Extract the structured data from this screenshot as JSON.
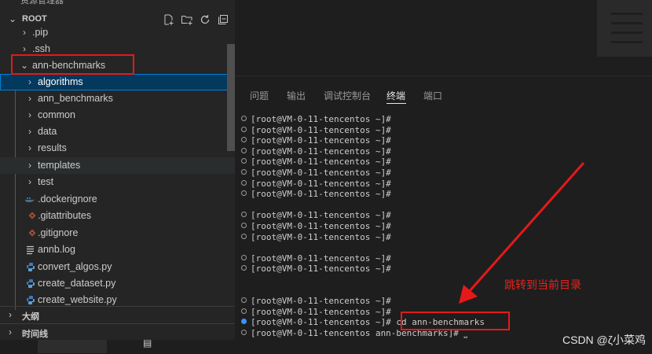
{
  "explorer": {
    "title_fragment": "资源管理器",
    "root_label": "ROOT",
    "header_icons": [
      "new-file-icon",
      "new-folder-icon",
      "refresh-icon",
      "collapse-all-icon"
    ],
    "items": [
      {
        "label": ".pip",
        "kind": "folder"
      },
      {
        "label": ".ssh",
        "kind": "folder"
      },
      {
        "label": "ann-benchmarks",
        "kind": "folder-open"
      },
      {
        "label": "algorithms",
        "kind": "folder",
        "selected": true
      },
      {
        "label": "ann_benchmarks",
        "kind": "folder"
      },
      {
        "label": "common",
        "kind": "folder"
      },
      {
        "label": "data",
        "kind": "folder"
      },
      {
        "label": "results",
        "kind": "folder"
      },
      {
        "label": "templates",
        "kind": "folder",
        "hover": true
      },
      {
        "label": "test",
        "kind": "folder"
      },
      {
        "label": ".dockerignore",
        "kind": "file",
        "icon": "docker-icon"
      },
      {
        "label": ".gitattributes",
        "kind": "file",
        "icon": "git-icon"
      },
      {
        "label": ".gitignore",
        "kind": "file",
        "icon": "git-icon"
      },
      {
        "label": "annb.log",
        "kind": "file",
        "icon": "log-icon"
      },
      {
        "label": "convert_algos.py",
        "kind": "file",
        "icon": "python-icon"
      },
      {
        "label": "create_dataset.py",
        "kind": "file",
        "icon": "python-icon"
      },
      {
        "label": "create_website.py",
        "kind": "file",
        "icon": "python-icon"
      }
    ],
    "sections": [
      "大纲",
      "时间线"
    ]
  },
  "panel": {
    "tabs": [
      "问题",
      "输出",
      "调试控制台",
      "终端",
      "端口"
    ],
    "active_tab": "终端"
  },
  "terminal": {
    "lines": [
      {
        "text": "[root@VM-0-11-tencentos ~]#"
      },
      {
        "text": "[root@VM-0-11-tencentos ~]#"
      },
      {
        "text": "[root@VM-0-11-tencentos ~]#"
      },
      {
        "text": "[root@VM-0-11-tencentos ~]#"
      },
      {
        "text": "[root@VM-0-11-tencentos ~]#"
      },
      {
        "text": "[root@VM-0-11-tencentos ~]#"
      },
      {
        "text": "[root@VM-0-11-tencentos ~]#"
      },
      {
        "text": "[root@VM-0-11-tencentos ~]#"
      },
      {
        "text": ""
      },
      {
        "text": "[root@VM-0-11-tencentos ~]#"
      },
      {
        "text": "[root@VM-0-11-tencentos ~]#"
      },
      {
        "text": "[root@VM-0-11-tencentos ~]#"
      },
      {
        "text": ""
      },
      {
        "text": "[root@VM-0-11-tencentos ~]#"
      },
      {
        "text": "[root@VM-0-11-tencentos ~]#"
      },
      {
        "text": ""
      },
      {
        "text": ""
      },
      {
        "text": "[root@VM-0-11-tencentos ~]#"
      },
      {
        "text": "[root@VM-0-11-tencentos ~]#"
      },
      {
        "text": "[root@VM-0-11-tencentos ~]# cd ann-benchmarks",
        "active": true
      },
      {
        "text": "[root@VM-0-11-tencentos ann-benchmarks]# ⎵"
      }
    ]
  },
  "annotation": {
    "text": "跳转到当前目录",
    "color": "#e8221f"
  },
  "watermark": "CSDN @ζ小菜鸡",
  "colors": {
    "selection_bg": "#04395e",
    "selection_border": "#007fd4",
    "highlight_box": "#e51919"
  }
}
